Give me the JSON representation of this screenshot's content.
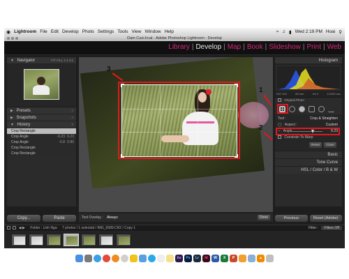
{
  "menubar": {
    "apple": "",
    "app_name": "Lightroom",
    "items": [
      "File",
      "Edit",
      "Develop",
      "Photo",
      "Settings",
      "Tools",
      "View",
      "Window",
      "Help"
    ],
    "clock": "Wed 2:19 PM",
    "user": "Hoai"
  },
  "window": {
    "title": "Dam Cuoi.lrcat - Adobe Photoshop Lightroom - Develop"
  },
  "modules": [
    {
      "label": "Library",
      "active": false
    },
    {
      "label": "Develop",
      "active": true
    },
    {
      "label": "Map",
      "active": false
    },
    {
      "label": "Book",
      "active": false
    },
    {
      "label": "Slideshow",
      "active": false
    },
    {
      "label": "Print",
      "active": false
    },
    {
      "label": "Web",
      "active": false
    }
  ],
  "module_separator": "|",
  "left_panel": {
    "navigator": {
      "title": "Navigator",
      "zoom_options": "FIT  FILL  1:1  3:1"
    },
    "presets": "Presets",
    "snapshots": "Snapshots",
    "history": {
      "title": "History",
      "rows": [
        {
          "label": "Crop Rectangle",
          "v1": "",
          "v2": ""
        },
        {
          "label": "Crop Angle",
          "v1": "-6.23",
          "v2": "6.23"
        },
        {
          "label": "Crop Angle",
          "v1": "-0.8",
          "v2": "0.80"
        },
        {
          "label": "Crop Rectangle",
          "v1": "",
          "v2": ""
        },
        {
          "label": "Crop Rectangle",
          "v1": "",
          "v2": ""
        }
      ]
    },
    "copy_button": "Copy...",
    "paste_button": "Paste"
  },
  "toolbar": {
    "tool_overlay_label": "Tool Overlay :",
    "tool_overlay_value": "Always",
    "done_button": "Done"
  },
  "right_panel": {
    "histogram_title": "Histogram",
    "histogram_info": [
      "ISO 100",
      "85 mm",
      "f/4.0",
      "1/1000 sec"
    ],
    "original_photo": "Original Photo",
    "tool_label": "Tool :",
    "crop_title": "Crop & Straighten",
    "aspect_label": "Aspect :",
    "aspect_value": "Custom",
    "angle_label": "Angle",
    "angle_value": "6.23",
    "constrain_label": "Constrain To Warp",
    "reset_button": "Reset",
    "close_button": "Close",
    "sections": [
      "Basic",
      "Tone Curve",
      "HSL / Color / B & W"
    ],
    "previous_button": "Previous",
    "reset_adobe_button": "Reset (Adobe)"
  },
  "filmbar": {
    "folder": "Folder : Linh Nga",
    "count": "7 photos / 1 selected / IMG_6589.CR2 / Copy 1",
    "filter_label": "Filter :",
    "filter_value": "Filters Off"
  },
  "annotations": [
    "1",
    "2",
    "3"
  ],
  "colors": {
    "accent": "#d4267a",
    "annotation_red": "#e4161e"
  },
  "dock_apps": [
    "Finder",
    "Launchpad",
    "Safari",
    "Chrome",
    "Firefox",
    "iTunes",
    "Photos",
    "Mail",
    "Skype",
    "Calendar",
    "Notes",
    "Ae",
    "Ps",
    "Lr",
    "Id",
    "Word",
    "Excel",
    "PowerPoint",
    "Pages",
    "Preview",
    "VLC",
    "Trash"
  ]
}
